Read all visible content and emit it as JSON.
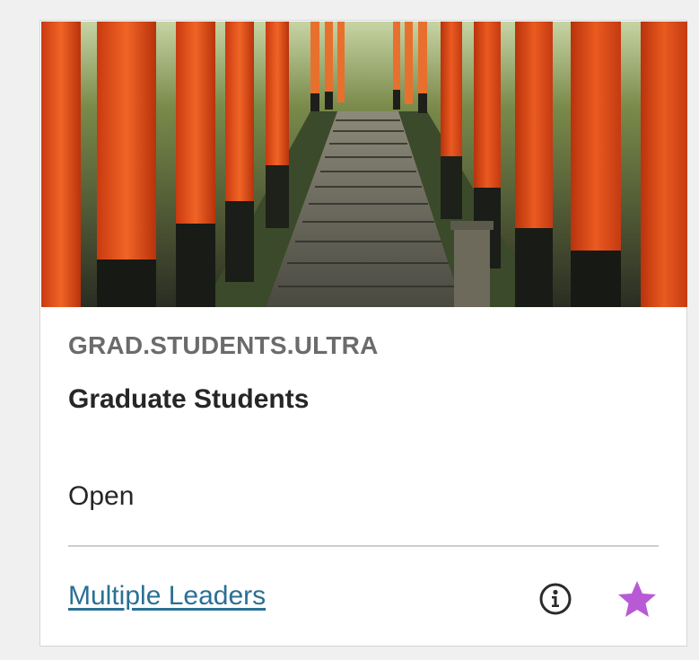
{
  "course": {
    "id": "GRAD.STUDENTS.ULTRA",
    "name": "Graduate Students",
    "status": "Open",
    "leaders_link": "Multiple Leaders"
  },
  "banner": {
    "subject": "torii-gate-tunnel-stairs"
  },
  "icons": {
    "info": "info-icon",
    "favorite": "star-icon"
  },
  "colors": {
    "link": "#2a6f96",
    "favorite_star": "#b85ad6",
    "gate_orange": "#e8521c",
    "muted_text": "#6b6b6b"
  }
}
